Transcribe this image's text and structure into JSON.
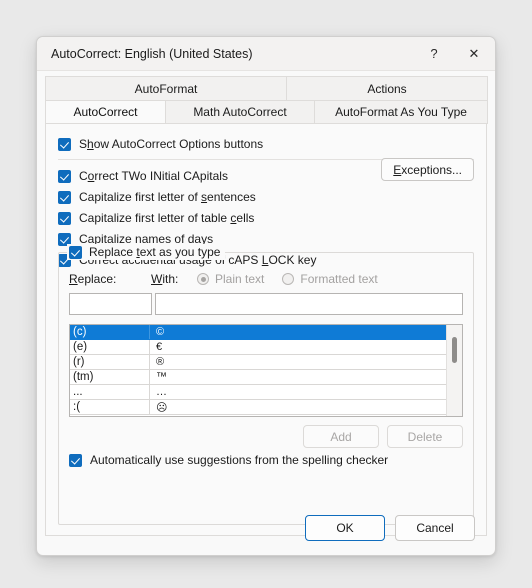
{
  "window": {
    "title": "AutoCorrect: English (United States)",
    "help_icon": "?",
    "close_icon": "✕"
  },
  "tabs": {
    "row1": [
      {
        "label": "AutoFormat",
        "active": false
      },
      {
        "label": "Actions",
        "active": false
      }
    ],
    "row2": [
      {
        "label": "AutoCorrect",
        "active": true
      },
      {
        "label": "Math AutoCorrect",
        "active": false
      },
      {
        "label": "AutoFormat As You Type",
        "active": false
      }
    ]
  },
  "options": {
    "show_options_buttons": {
      "pre": "S",
      "accel": "h",
      "post": "ow AutoCorrect Options buttons",
      "checked": true
    },
    "two_initial_capitals": {
      "pre": "C",
      "accel": "o",
      "post": "rrect TWo INitial CApitals",
      "checked": true
    },
    "capitalize_sentences": {
      "pre": "Capitalize first letter of ",
      "accel": "s",
      "post": "entences",
      "checked": true
    },
    "capitalize_table_cells": {
      "pre": "Capitalize first letter of table ",
      "accel": "c",
      "post": "ells",
      "checked": true
    },
    "capitalize_days": {
      "pre": "Capitalize ",
      "accel": "n",
      "post": "ames of days",
      "checked": true
    },
    "caps_lock": {
      "pre": "Correct accidental usage of cAPS ",
      "accel": "L",
      "post": "OCK key",
      "checked": true
    },
    "exceptions_button": {
      "pre": "",
      "accel": "E",
      "post": "xceptions..."
    }
  },
  "replace_group": {
    "title": {
      "pre": "Replace ",
      "accel": "t",
      "post": "ext as you type",
      "checked": true
    },
    "replace_label": {
      "pre": "",
      "accel": "R",
      "post": "eplace:"
    },
    "with_label": {
      "pre": "",
      "accel": "W",
      "post": "ith:"
    },
    "radios": [
      {
        "label": "Plain text",
        "selected": true,
        "disabled": true
      },
      {
        "label": "Formatted text",
        "selected": false,
        "disabled": true
      }
    ],
    "replace_input": {
      "value": "",
      "placeholder": ""
    },
    "with_input": {
      "value": "",
      "placeholder": ""
    },
    "list": {
      "rows": [
        {
          "key": "(c)",
          "value": "©",
          "selected": true
        },
        {
          "key": "(e)",
          "value": "€",
          "selected": false
        },
        {
          "key": "(r)",
          "value": "®",
          "selected": false
        },
        {
          "key": "(tm)",
          "value": "™",
          "selected": false
        },
        {
          "key": "...",
          "value": "…",
          "selected": false
        },
        {
          "key": ":(",
          "value": "☹",
          "selected": false
        }
      ]
    },
    "add_button": "Add",
    "delete_button": "Delete",
    "spelling_checker": {
      "pre": "Automatically use sug",
      "accel": "g",
      "post": "estions from the spelling checker",
      "checked": true
    }
  },
  "footer": {
    "ok": "OK",
    "cancel": "Cancel"
  },
  "colors": {
    "accent": "#0f6cbd",
    "selection": "#0f7bd6",
    "dialog_bg": "#f9f9f9",
    "panel_bg": "#fafafa",
    "page_bg": "#e9e9e9"
  }
}
